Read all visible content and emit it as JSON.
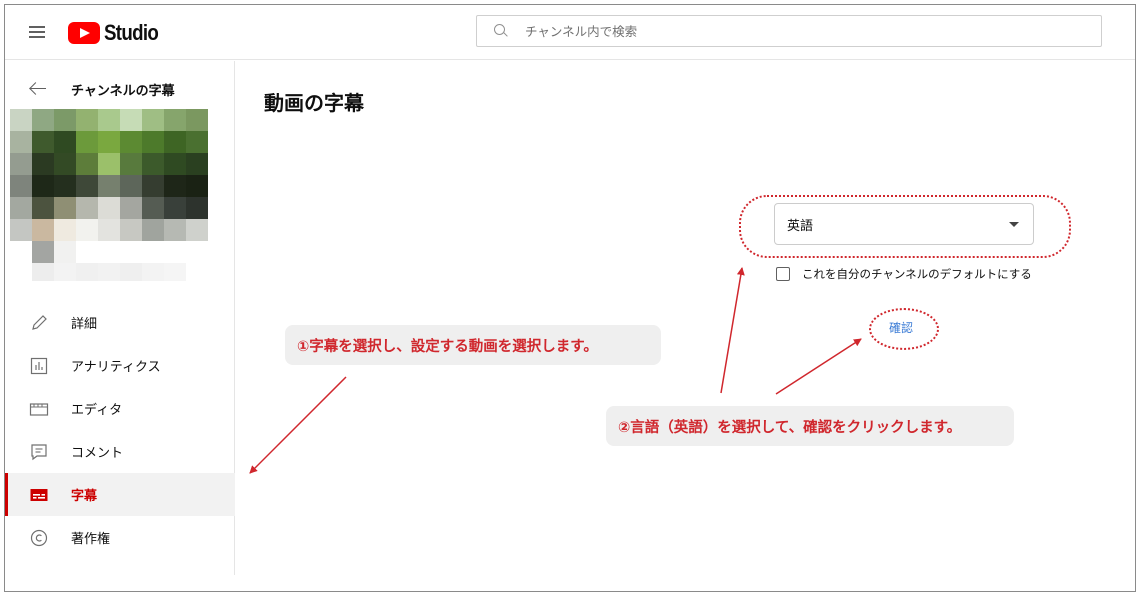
{
  "header": {
    "logo_text": "Studio",
    "search_placeholder": "チャンネル内で検索"
  },
  "sidebar": {
    "back_title": "チャンネルの字幕",
    "items": [
      {
        "label": "詳細",
        "icon": "pencil-icon",
        "active": false
      },
      {
        "label": "アナリティクス",
        "icon": "analytics-icon",
        "active": false
      },
      {
        "label": "エディタ",
        "icon": "editor-icon",
        "active": false
      },
      {
        "label": "コメント",
        "icon": "comment-icon",
        "active": false
      },
      {
        "label": "字幕",
        "icon": "subtitles-icon",
        "active": true
      },
      {
        "label": "著作権",
        "icon": "copyright-icon",
        "active": false
      }
    ]
  },
  "main": {
    "title": "動画の字幕",
    "language_select": {
      "value": "英語"
    },
    "default_checkbox_label": "これを自分のチャンネルのデフォルトにする",
    "confirm_label": "確認"
  },
  "annotations": {
    "callout_1": "①字幕を選択し、設定する動画を選択します。",
    "callout_2": "②言語（英語）を選択して、確認をクリックします。",
    "color": "#d0272d"
  },
  "colors": {
    "accent_red": "#cc0000",
    "link_blue": "#3a7bd5"
  }
}
